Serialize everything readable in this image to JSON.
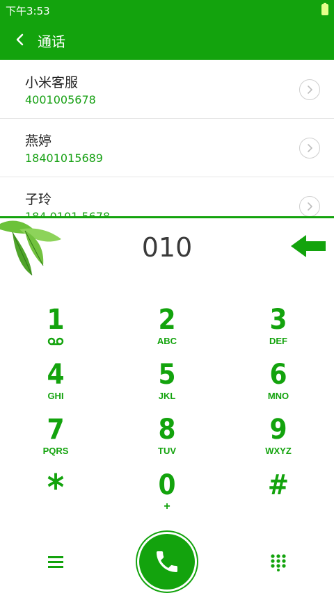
{
  "status": {
    "time": "下午3:53"
  },
  "header": {
    "title": "通话"
  },
  "contacts": [
    {
      "name": "小米客服",
      "number": "4001005678"
    },
    {
      "name": "燕婷",
      "number": "18401015689"
    },
    {
      "name": "子玲",
      "number": "184 0101 5678"
    }
  ],
  "dialer": {
    "entered": "010",
    "keys": [
      {
        "digit": "1",
        "letters": ""
      },
      {
        "digit": "2",
        "letters": "ABC"
      },
      {
        "digit": "3",
        "letters": "DEF"
      },
      {
        "digit": "4",
        "letters": "GHI"
      },
      {
        "digit": "5",
        "letters": "JKL"
      },
      {
        "digit": "6",
        "letters": "MNO"
      },
      {
        "digit": "7",
        "letters": "PQRS"
      },
      {
        "digit": "8",
        "letters": "TUV"
      },
      {
        "digit": "9",
        "letters": "WXYZ"
      },
      {
        "digit": "*",
        "letters": ""
      },
      {
        "digit": "0",
        "letters": "+"
      },
      {
        "digit": "#",
        "letters": ""
      }
    ]
  },
  "colors": {
    "accent": "#13a30d",
    "text": "#222222",
    "number": "#18a115"
  },
  "icons": [
    "back-icon",
    "chevron-right-icon",
    "voicemail-icon",
    "backspace-arrow-icon",
    "menu-icon",
    "phone-icon",
    "dialpad-icon",
    "leaf-decoration"
  ]
}
